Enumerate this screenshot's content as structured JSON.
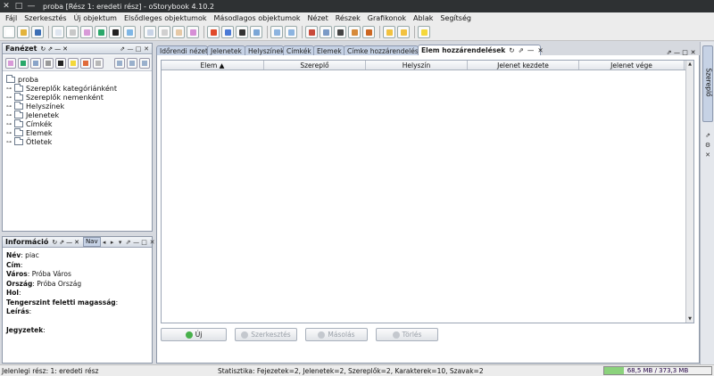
{
  "window": {
    "title": "proba [Rész 1: eredeti rész] - oStorybook 4.10.2",
    "controls": [
      "✕",
      "□",
      "—"
    ]
  },
  "menu": [
    "Fájl",
    "Szerkesztés",
    "Új objektum",
    "Elsődleges objektumok",
    "Másodlagos objektumok",
    "Nézet",
    "Részek",
    "Grafikonok",
    "Ablak",
    "Segítség"
  ],
  "toolbar_icons": [
    {
      "name": "new-file-icon",
      "color": "#ffffff"
    },
    {
      "name": "open-folder-icon",
      "color": "#e2b33c"
    },
    {
      "name": "save-icon",
      "color": "#3c6fb5"
    },
    {
      "sep": true
    },
    {
      "name": "chapter-icon",
      "color": "#dfe6f0"
    },
    {
      "name": "part-icon",
      "color": "#c8c8c8"
    },
    {
      "name": "character-icon",
      "color": "#d89ad8"
    },
    {
      "name": "location-icon",
      "color": "#2aa86a"
    },
    {
      "name": "gender-icon",
      "color": "#222222"
    },
    {
      "name": "tag-icon",
      "color": "#7fb7e6"
    },
    {
      "sep": true
    },
    {
      "name": "chrono-view-icon",
      "color": "#c9d4e6"
    },
    {
      "name": "book-view-icon",
      "color": "#d0d0d0"
    },
    {
      "name": "manage-view-icon",
      "color": "#e6c9a6"
    },
    {
      "name": "reading-view-icon",
      "color": "#d68fd6"
    },
    {
      "sep": true
    },
    {
      "name": "chart-icon",
      "color": "#e04a2a"
    },
    {
      "name": "gantt-icon",
      "color": "#4a7ad6"
    },
    {
      "name": "memoria-icon",
      "color": "#333333"
    },
    {
      "name": "scene-icon",
      "color": "#7aa6d6"
    },
    {
      "sep": true
    },
    {
      "name": "undo-icon",
      "color": "#8cb4e0"
    },
    {
      "name": "redo-icon",
      "color": "#8cb4e0"
    },
    {
      "sep": true
    },
    {
      "name": "print-icon",
      "color": "#c84a3a"
    },
    {
      "name": "export-icon",
      "color": "#7a9ac6"
    },
    {
      "name": "list-icon",
      "color": "#444444"
    },
    {
      "name": "search-icon",
      "color": "#d68a3a"
    },
    {
      "name": "web-icon",
      "color": "#cc6622"
    },
    {
      "sep": true
    },
    {
      "name": "arrow-left-icon",
      "color": "#f2c240"
    },
    {
      "name": "arrow-right-icon",
      "color": "#f2c240"
    },
    {
      "sep": true
    },
    {
      "name": "idea-bulb-icon",
      "color": "#f4d83a"
    }
  ],
  "tree_panel": {
    "title": "Fanézet",
    "controls": [
      "↻",
      "⇗",
      "—",
      "✕"
    ],
    "controls2": [
      "⇗",
      "—",
      "□",
      "✕"
    ],
    "nav_icons": [
      {
        "name": "character-filter-icon",
        "color": "#d89ad8"
      },
      {
        "name": "location-filter-icon",
        "color": "#2aa86a"
      },
      {
        "name": "chapter-filter-icon",
        "color": "#8aa4c8"
      },
      {
        "name": "part-filter-icon",
        "color": "#9a9a9a"
      },
      {
        "name": "gender-filter-icon",
        "color": "#222222"
      },
      {
        "name": "idea-filter-icon",
        "color": "#f4d83a"
      },
      {
        "name": "color-filter-icon",
        "color": "#e06a3a"
      },
      {
        "name": "grid-filter-icon",
        "color": "#b8b8b8"
      },
      {
        "name": "expand-all-icon",
        "color": "#9ab0cc"
      },
      {
        "name": "collapse-all-icon",
        "color": "#9ab0cc"
      },
      {
        "name": "tree-settings-icon",
        "color": "#9ab0cc"
      }
    ],
    "root": "proba",
    "items": [
      "Szereplők kategóriánként",
      "Szereplők nemenként",
      "Helyszínek",
      "Jelenetek",
      "Címkék",
      "Elemek",
      "Ötletek"
    ]
  },
  "info_panel": {
    "title": "Információ",
    "tab": "Nav",
    "controls": [
      "↻",
      "⇗",
      "—",
      "✕"
    ],
    "controls2": [
      "◂",
      "▸",
      "▾",
      "⇗",
      "—",
      "□",
      "✕"
    ],
    "fields": [
      {
        "label": "Név",
        "value": " piac"
      },
      {
        "label": "Cím",
        "value": ""
      },
      {
        "label": "Város",
        "value": " Próba Város"
      },
      {
        "label": "Ország",
        "value": " Próba Ország"
      },
      {
        "label": "Hol",
        "value": ""
      },
      {
        "label": "Tengerszint feletti magasság",
        "value": ""
      },
      {
        "label": "Leírás",
        "value": ""
      },
      {
        "label": "",
        "value": ""
      },
      {
        "label": "Jegyzetek",
        "value": ""
      }
    ]
  },
  "tabs": [
    {
      "label": "Időrendi nézet",
      "w": 58
    },
    {
      "label": "Jelenetek",
      "w": 43
    },
    {
      "label": "Helyszínek",
      "w": 44
    },
    {
      "label": "Címkék",
      "w": 35
    },
    {
      "label": "Elemek",
      "w": 35
    },
    {
      "label": "Címke hozzárendelés",
      "w": 84
    },
    {
      "label": "Elem hozzárendelések",
      "w": 138
    }
  ],
  "active_tab": {
    "icons": [
      "↻",
      "⇗",
      "—",
      "✕"
    ]
  },
  "tab_controls": [
    "⇗",
    "—",
    "□",
    "✕"
  ],
  "table": {
    "columns": [
      {
        "label": "Elem ▲",
        "w": 115
      },
      {
        "label": "Szereplő",
        "w": 114
      },
      {
        "label": "Helyszín",
        "w": 114
      },
      {
        "label": "Jelenet kezdete",
        "w": 125
      },
      {
        "label": "Jelenet vége",
        "w": 118
      }
    ],
    "scroll_up": "▲",
    "scroll_down": "▼"
  },
  "buttons": [
    {
      "label": "Új",
      "name": "new-button",
      "enabled": true,
      "icon": "#47b04a",
      "w": 74
    },
    {
      "label": "Szerkesztés",
      "name": "edit-button",
      "enabled": false,
      "icon": "#c4c8ce",
      "w": 70
    },
    {
      "label": "Másolás",
      "name": "copy-button",
      "enabled": false,
      "icon": "#c4c8ce",
      "w": 70
    },
    {
      "label": "Törlés",
      "name": "delete-button",
      "enabled": false,
      "icon": "#c4c8ce",
      "w": 70
    }
  ],
  "right_sidebar": {
    "tab": "Szereplő",
    "controls": [
      "⇗",
      "⚙",
      "✕"
    ]
  },
  "status": {
    "left": "Jelenlegi rész: 1: eredeti rész",
    "stats": "Statisztika: Fejezetek=2,  Jelenetek=2,  Szereplők=2,  Karakterek=10,  Szavak=2",
    "memory_label": "68,5 MB / 373,3 MB",
    "memory_fraction": 0.183
  }
}
